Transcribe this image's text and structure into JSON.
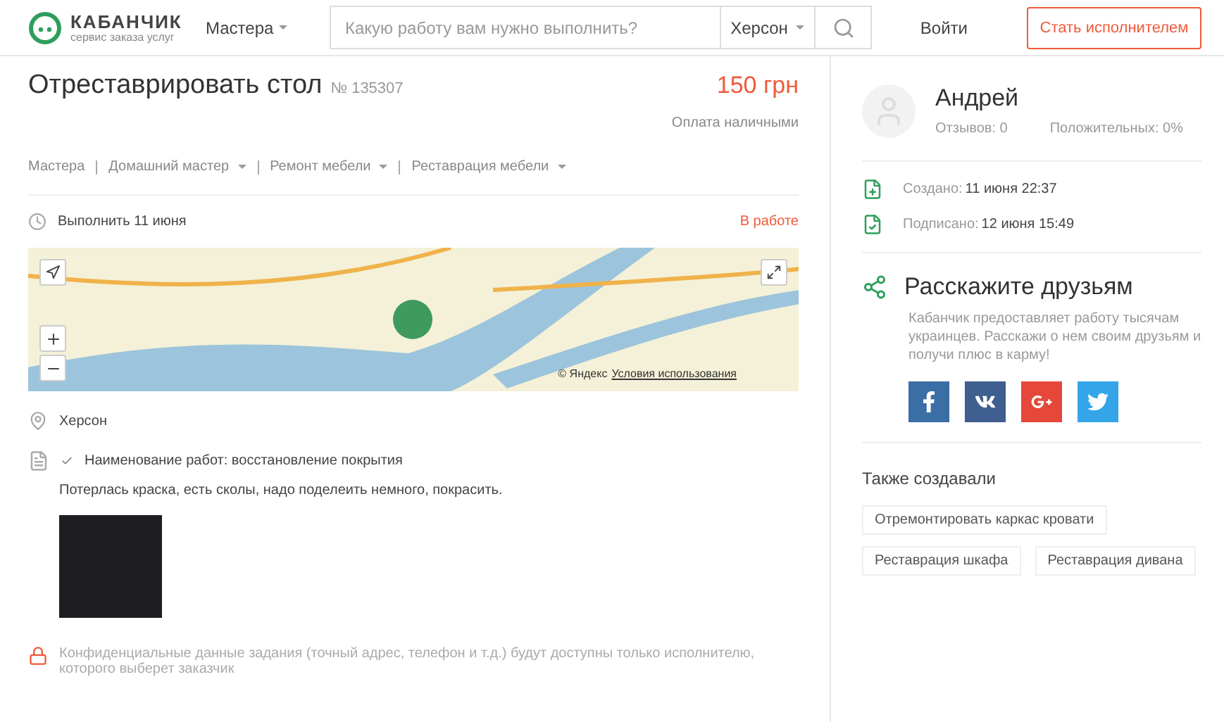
{
  "header": {
    "logo_title": "КАБАНЧИК",
    "logo_subtitle": "сервис заказа услуг",
    "menu_label": "Мастера",
    "search": {
      "placeholder": "Какую работу вам нужно выполнить?"
    },
    "city": "Херсон",
    "login": "Войти",
    "cta": "Стать исполнителем"
  },
  "task": {
    "title": "Отреставрировать стол",
    "number": "№ 135307",
    "price": "150 грн",
    "payment": "Оплата наличными",
    "breadcrumbs": [
      {
        "label": "Мастера",
        "dropdown": false
      },
      {
        "label": "Домашний мастер",
        "dropdown": true
      },
      {
        "label": "Ремонт мебели",
        "dropdown": true
      },
      {
        "label": "Реставрация мебели",
        "dropdown": true
      }
    ],
    "deadline": "Выполнить 11 июня",
    "status": "В работе",
    "map": {
      "attribution": "© Яндекс",
      "terms": "Условия использования"
    },
    "location": "Херсон",
    "work_name": "Наименование работ: восстановление покрытия",
    "description": "Потерлась краска, есть сколы, надо поделеить немного, покрасить.",
    "privacy_note": "Конфиденциальные данные задания (точный адрес, телефон и т.д.) будут доступны только исполнителю, которого выберет заказчик"
  },
  "customer": {
    "name": "Андрей",
    "reviews": "Отзывов: 0",
    "positive": "Положительных: 0%"
  },
  "events": [
    {
      "kind": "created",
      "label": "Создано:",
      "value": "11 июня 22:37"
    },
    {
      "kind": "signed",
      "label": "Подписано:",
      "value": "12 июня 15:49"
    }
  ],
  "share": {
    "title": "Расскажите друзьям",
    "text": "Кабанчик предоставляет работу тысячам украинцев. Расскажи о нем своим друзьям и получи плюс в карму!",
    "networks": [
      {
        "kind": "facebook",
        "color": "#3b6ea5"
      },
      {
        "kind": "vk",
        "color": "#3e5f8f"
      },
      {
        "kind": "google",
        "color": "#e5483a"
      },
      {
        "kind": "twitter",
        "color": "#34a5e8"
      }
    ]
  },
  "related": {
    "title": "Также создавали",
    "items": [
      "Отремонтировать каркас кровати",
      "Реставрация шкафа",
      "Реставрация дивана"
    ]
  }
}
